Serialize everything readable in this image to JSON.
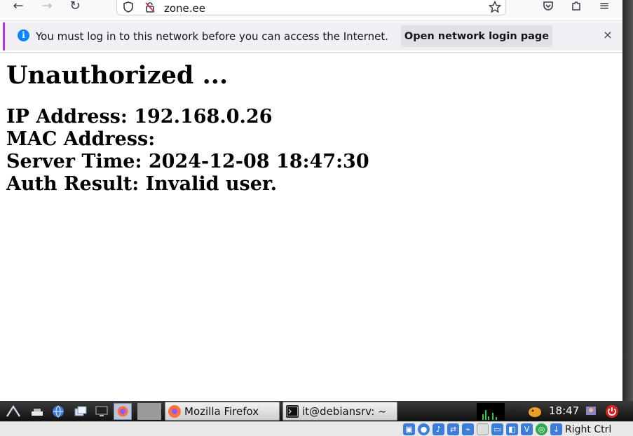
{
  "browser": {
    "url": "zone.ee",
    "back_glyph": "←",
    "forward_glyph": "→",
    "reload_glyph": "↻",
    "menu_glyph": "≡"
  },
  "notification": {
    "message": "You must log in to this network before you can access the Internet.",
    "button_label": "Open network login page",
    "close_glyph": "×",
    "info_glyph": "i",
    "accent_color": "#0a84ff"
  },
  "page": {
    "heading": "Unauthorized ...",
    "lines": [
      "IP Address: 192.168.0.26",
      "MAC Address:",
      "Server Time: 2024-12-08 18:47:30",
      "Auth Result: Invalid user."
    ]
  },
  "taskbar": {
    "tasks": [
      {
        "label": "Mozilla Firefox",
        "icon": "firefox-icon"
      },
      {
        "label": "it@debiansrv: ~",
        "icon": "terminal-icon"
      }
    ],
    "clock": "18:47"
  },
  "statusbar": {
    "host_key": "Right Ctrl"
  }
}
